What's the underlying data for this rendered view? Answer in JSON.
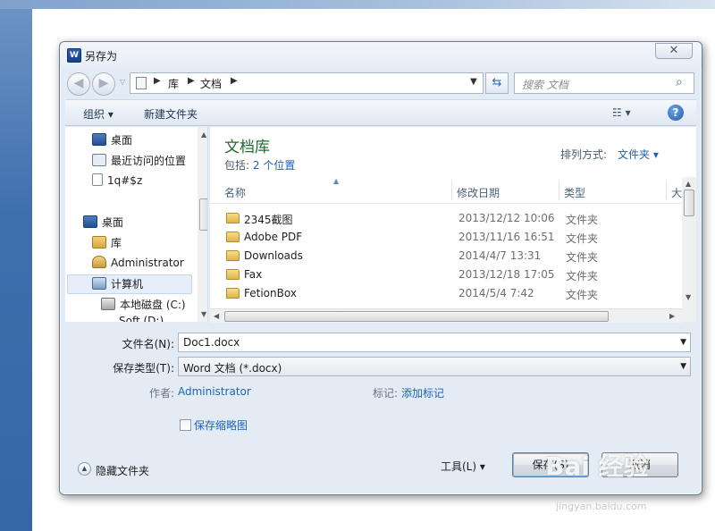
{
  "dialog": {
    "title": "另存为",
    "icon_text": "W",
    "close_symbol": "✕"
  },
  "address": {
    "segments": [
      "库",
      "文档"
    ],
    "refresh_symbol": "⇆"
  },
  "search": {
    "placeholder": "搜索 文档"
  },
  "toolbar": {
    "organize": "组织 ▾",
    "new_folder": "新建文件夹",
    "view_symbol": "☷ ▾",
    "help_symbol": "?"
  },
  "nav": {
    "items": [
      {
        "label": "桌面",
        "icon": "desktop-icon"
      },
      {
        "label": "最近访问的位置",
        "icon": "recent-places-icon"
      },
      {
        "label": "1q#$z",
        "icon": "file-icon"
      },
      {
        "label": "桌面",
        "icon": "desktop-icon"
      },
      {
        "label": "库",
        "icon": "library-icon"
      },
      {
        "label": "Administrator",
        "icon": "user-folder-icon"
      },
      {
        "label": "计算机",
        "icon": "computer-icon"
      },
      {
        "label": "本地磁盘 (C:)",
        "icon": "disk-icon"
      },
      {
        "label": "Soft (D:)",
        "icon": "disk-icon"
      }
    ]
  },
  "library": {
    "title": "文档库",
    "includes_label": "包括:",
    "locations_link": "2 个位置",
    "arrange_label": "排列方式:",
    "arrange_value": "文件夹 ▾"
  },
  "columns": {
    "name": "名称",
    "date": "修改日期",
    "type": "类型",
    "size": "大"
  },
  "files": [
    {
      "name": "2345截图",
      "date": "2013/12/12 10:06",
      "type": "文件夹"
    },
    {
      "name": "Adobe PDF",
      "date": "2013/11/16 16:51",
      "type": "文件夹"
    },
    {
      "name": "Downloads",
      "date": "2014/4/7 13:31",
      "type": "文件夹"
    },
    {
      "name": "Fax",
      "date": "2013/12/18 17:05",
      "type": "文件夹"
    },
    {
      "name": "FetionBox",
      "date": "2014/5/4 7:42",
      "type": "文件夹"
    }
  ],
  "form": {
    "filename_label": "文件名(N):",
    "filename_value": "Doc1.docx",
    "filetype_label": "保存类型(T):",
    "filetype_value": "Word 文档 (*.docx)",
    "author_label": "作者:",
    "author_value": "Administrator",
    "tags_label": "标记:",
    "tags_link": "添加标记",
    "thumbnail_label": "保存缩略图"
  },
  "footer": {
    "hide_folders": "隐藏文件夹",
    "tools": "工具(L)  ▾",
    "save": "保存(S)",
    "cancel": "取消"
  },
  "watermark": {
    "brand": "Bai 经验",
    "url": "jingyan.baidu.com"
  }
}
